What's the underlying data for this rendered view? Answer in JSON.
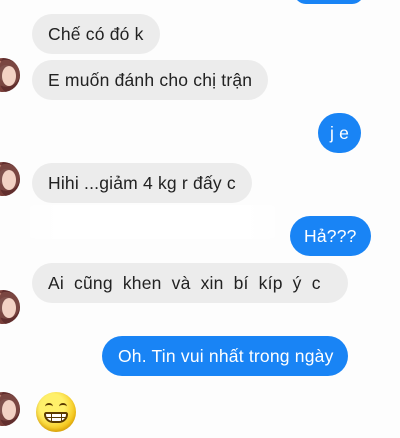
{
  "messages": [
    {
      "side": "in",
      "text": "Chế có đó k"
    },
    {
      "side": "in",
      "text": "E muốn đánh cho chị trận"
    },
    {
      "side": "out",
      "text": "j e"
    },
    {
      "side": "in",
      "text": "Hihi ...giảm 4 kg r đấy c"
    },
    {
      "side": "out",
      "text": "Hả???"
    },
    {
      "side": "in",
      "text": "Ai cũng khen và xin bí kíp ý c"
    },
    {
      "side": "out",
      "text": "Oh.  Tin vui nhất trong ngày"
    }
  ],
  "emoji": {
    "icon": "grinning-face-icon",
    "glyph": "😁"
  },
  "colors": {
    "incoming_bubble": "#ececec",
    "outgoing_bubble": "#1984f5",
    "outgoing_text": "#ffffff",
    "incoming_text": "#222222"
  }
}
